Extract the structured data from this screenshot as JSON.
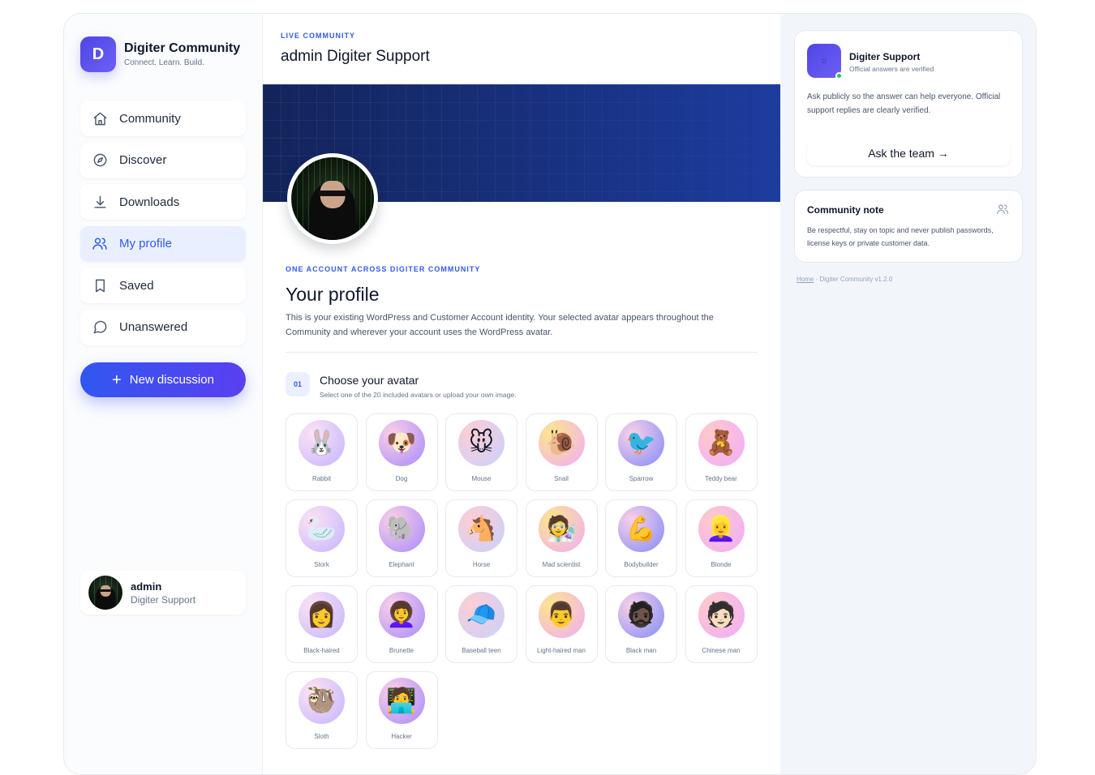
{
  "brand": {
    "logo_letter": "D",
    "title": "Digiter Community",
    "tagline": "Connect. Learn. Build."
  },
  "nav": {
    "items": [
      {
        "label": "Community",
        "icon": "home-icon"
      },
      {
        "label": "Discover",
        "icon": "compass-icon"
      },
      {
        "label": "Downloads",
        "icon": "download-icon"
      },
      {
        "label": "My profile",
        "icon": "users-icon",
        "active": true
      },
      {
        "label": "Saved",
        "icon": "bookmark-icon"
      },
      {
        "label": "Unanswered",
        "icon": "message-circle-icon"
      }
    ],
    "new_discussion": "New discussion"
  },
  "user": {
    "name": "admin",
    "role": "Digiter Support"
  },
  "header": {
    "eyebrow": "LIVE COMMUNITY",
    "title": "admin Digiter Support"
  },
  "profile": {
    "eyebrow": "ONE ACCOUNT ACROSS DIGITER COMMUNITY",
    "title": "Your profile",
    "description": "This is your existing WordPress and Customer Account identity. Your selected avatar appears throughout the Community and wherever your account uses the WordPress avatar."
  },
  "avatar_step": {
    "number": "01",
    "title": "Choose your avatar",
    "subtitle": "Select one of the 20 included avatars or upload your own image.",
    "avatars": [
      {
        "name": "Rabbit",
        "glyph": "🐰"
      },
      {
        "name": "Dog",
        "glyph": "🐶"
      },
      {
        "name": "Mouse",
        "glyph": "🐭"
      },
      {
        "name": "Snail",
        "glyph": "🐌"
      },
      {
        "name": "Sparrow",
        "glyph": "🐦"
      },
      {
        "name": "Teddy bear",
        "glyph": "🧸"
      },
      {
        "name": "Stork",
        "glyph": "🦢"
      },
      {
        "name": "Elephant",
        "glyph": "🐘"
      },
      {
        "name": "Horse",
        "glyph": "🐴"
      },
      {
        "name": "Mad scientist",
        "glyph": "🧑‍🔬"
      },
      {
        "name": "Bodybuilder",
        "glyph": "💪"
      },
      {
        "name": "Blonde",
        "glyph": "👱‍♀️"
      },
      {
        "name": "Black-haired",
        "glyph": "👩"
      },
      {
        "name": "Brunette",
        "glyph": "👩‍🦱"
      },
      {
        "name": "Baseball teen",
        "glyph": "🧢"
      },
      {
        "name": "Light-haired man",
        "glyph": "👨"
      },
      {
        "name": "Black man",
        "glyph": "🧔🏿"
      },
      {
        "name": "Chinese man",
        "glyph": "🧑🏻"
      },
      {
        "name": "Sloth",
        "glyph": "🦥"
      },
      {
        "name": "Hacker",
        "glyph": "🧑‍💻"
      }
    ]
  },
  "support_card": {
    "logo_text": "D",
    "name": "Digiter Support",
    "subtitle": "Official answers are verified",
    "description": "Ask publicly so the answer can help everyone. Official support replies are clearly verified.",
    "button": "Ask the team  →"
  },
  "note_card": {
    "title": "Community note",
    "description": "Be respectful, stay on topic and never publish passwords, license keys or private customer data."
  },
  "footer": {
    "home_link": "Home",
    "separator": "·",
    "version": "Digiter Community v1.2.0"
  },
  "colors": {
    "accent": "#2f5bea",
    "brand_gradient_start": "#4f46e5",
    "brand_gradient_end": "#6d5ff5",
    "online": "#22c55e"
  }
}
